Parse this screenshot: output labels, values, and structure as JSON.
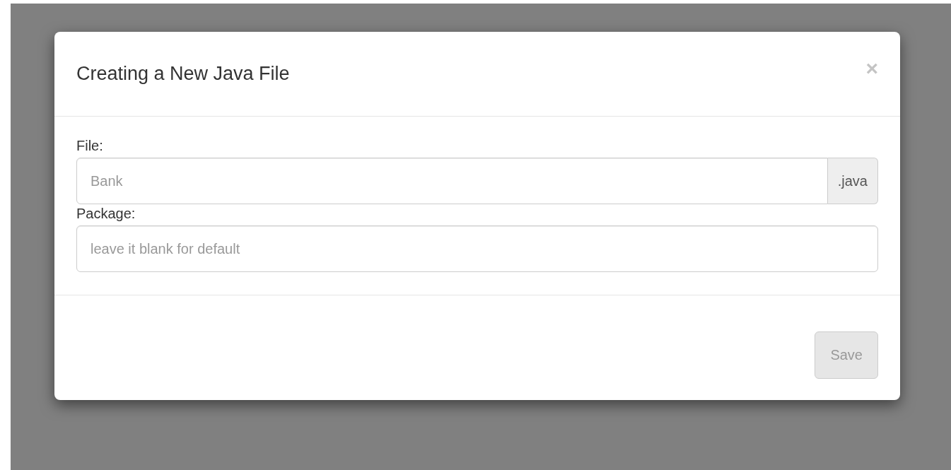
{
  "dialog": {
    "title": "Creating a New Java File",
    "close": "×"
  },
  "fields": [
    {
      "label": "File:",
      "placeholder": "Bank",
      "addon": ".java"
    },
    {
      "label": "Package:",
      "placeholder": "leave it blank for default"
    }
  ],
  "buttons": [
    {
      "label": "Save",
      "disabled": true
    }
  ]
}
